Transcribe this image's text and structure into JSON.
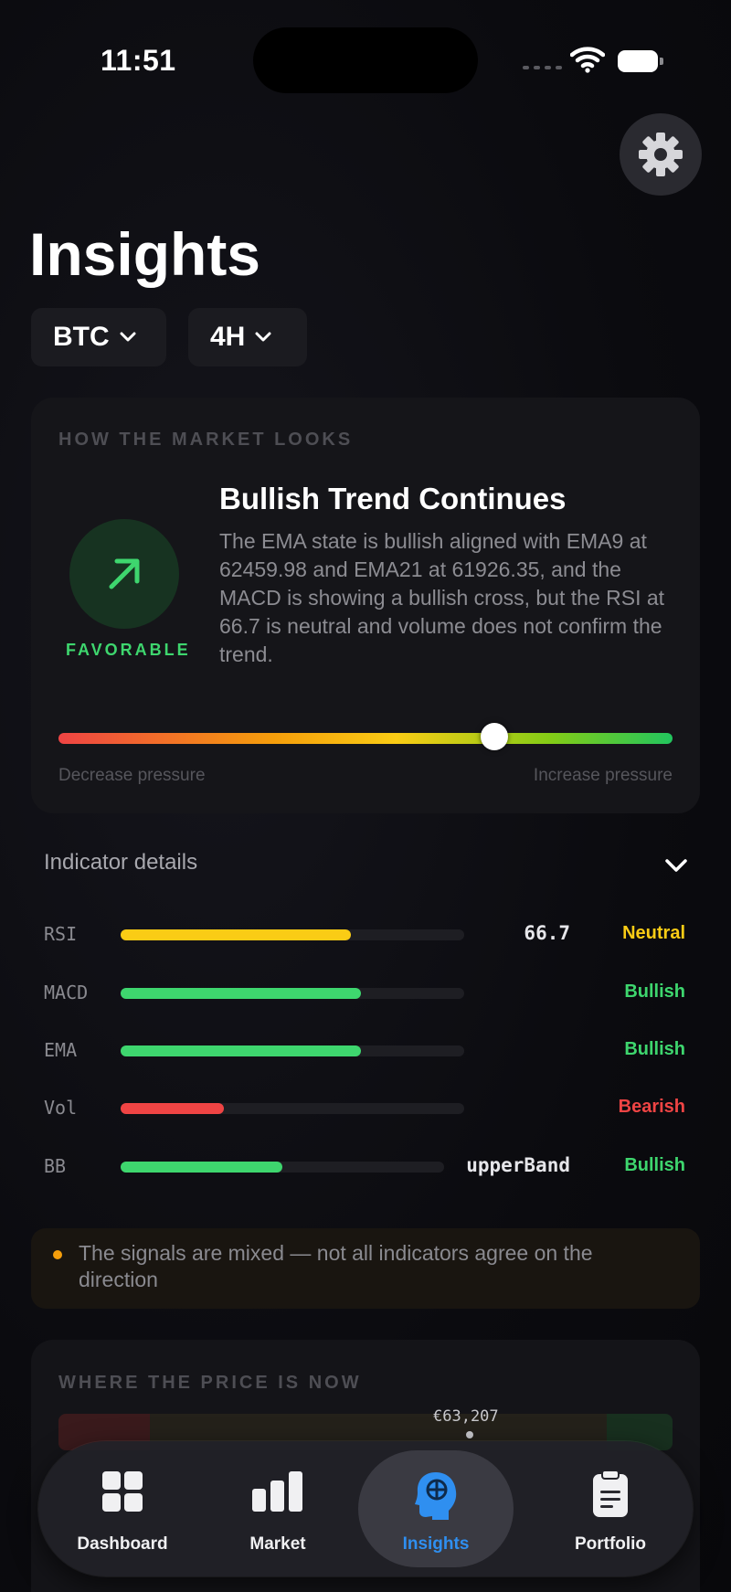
{
  "status_bar": {
    "time": "11:51"
  },
  "header": {
    "title": "Insights",
    "asset_selector": {
      "label": "BTC"
    },
    "timeframe_selector": {
      "label": "4H"
    }
  },
  "market_card": {
    "section_label": "HOW THE MARKET LOOKS",
    "status_label": "FAVORABLE",
    "headline": "Bullish Trend Continues",
    "description": "The EMA state is bullish aligned with EMA9 at 62459.98 and EMA21 at 61926.35, and the MACD is showing a bullish cross, but the RSI at 66.7 is neutral and volume does not confirm the trend.",
    "pressure": {
      "left_label": "Decrease pressure",
      "right_label": "Increase pressure",
      "position": 0.71
    },
    "colors": {
      "favorable": "#3ed66e"
    }
  },
  "indicators": {
    "header": "Indicator details",
    "rows": [
      {
        "name": "RSI",
        "fill": 0.67,
        "value": "66.7",
        "signal": "Neutral",
        "color": "#facc15"
      },
      {
        "name": "MACD",
        "fill": 0.7,
        "value": "",
        "signal": "Bullish",
        "color": "#3ed66e"
      },
      {
        "name": "EMA",
        "fill": 0.7,
        "value": "",
        "signal": "Bullish",
        "color": "#3ed66e"
      },
      {
        "name": "Vol",
        "fill": 0.3,
        "value": "",
        "signal": "Bearish",
        "color": "#ef4444"
      },
      {
        "name": "BB",
        "fill": 0.5,
        "value": "upperBand",
        "signal": "Bullish",
        "color": "#3ed66e"
      }
    ]
  },
  "note": {
    "text": "The signals are mixed — not all indicators agree on the direction"
  },
  "price_card": {
    "section_label": "WHERE THE PRICE IS NOW",
    "current_price": "€63,207"
  },
  "tab_bar": {
    "tabs": [
      {
        "label": "Dashboard",
        "icon": "grid-icon"
      },
      {
        "label": "Market",
        "icon": "bar-chart-icon"
      },
      {
        "label": "Insights",
        "icon": "brain-icon",
        "active": true
      },
      {
        "label": "Portfolio",
        "icon": "clipboard-icon"
      }
    ]
  }
}
